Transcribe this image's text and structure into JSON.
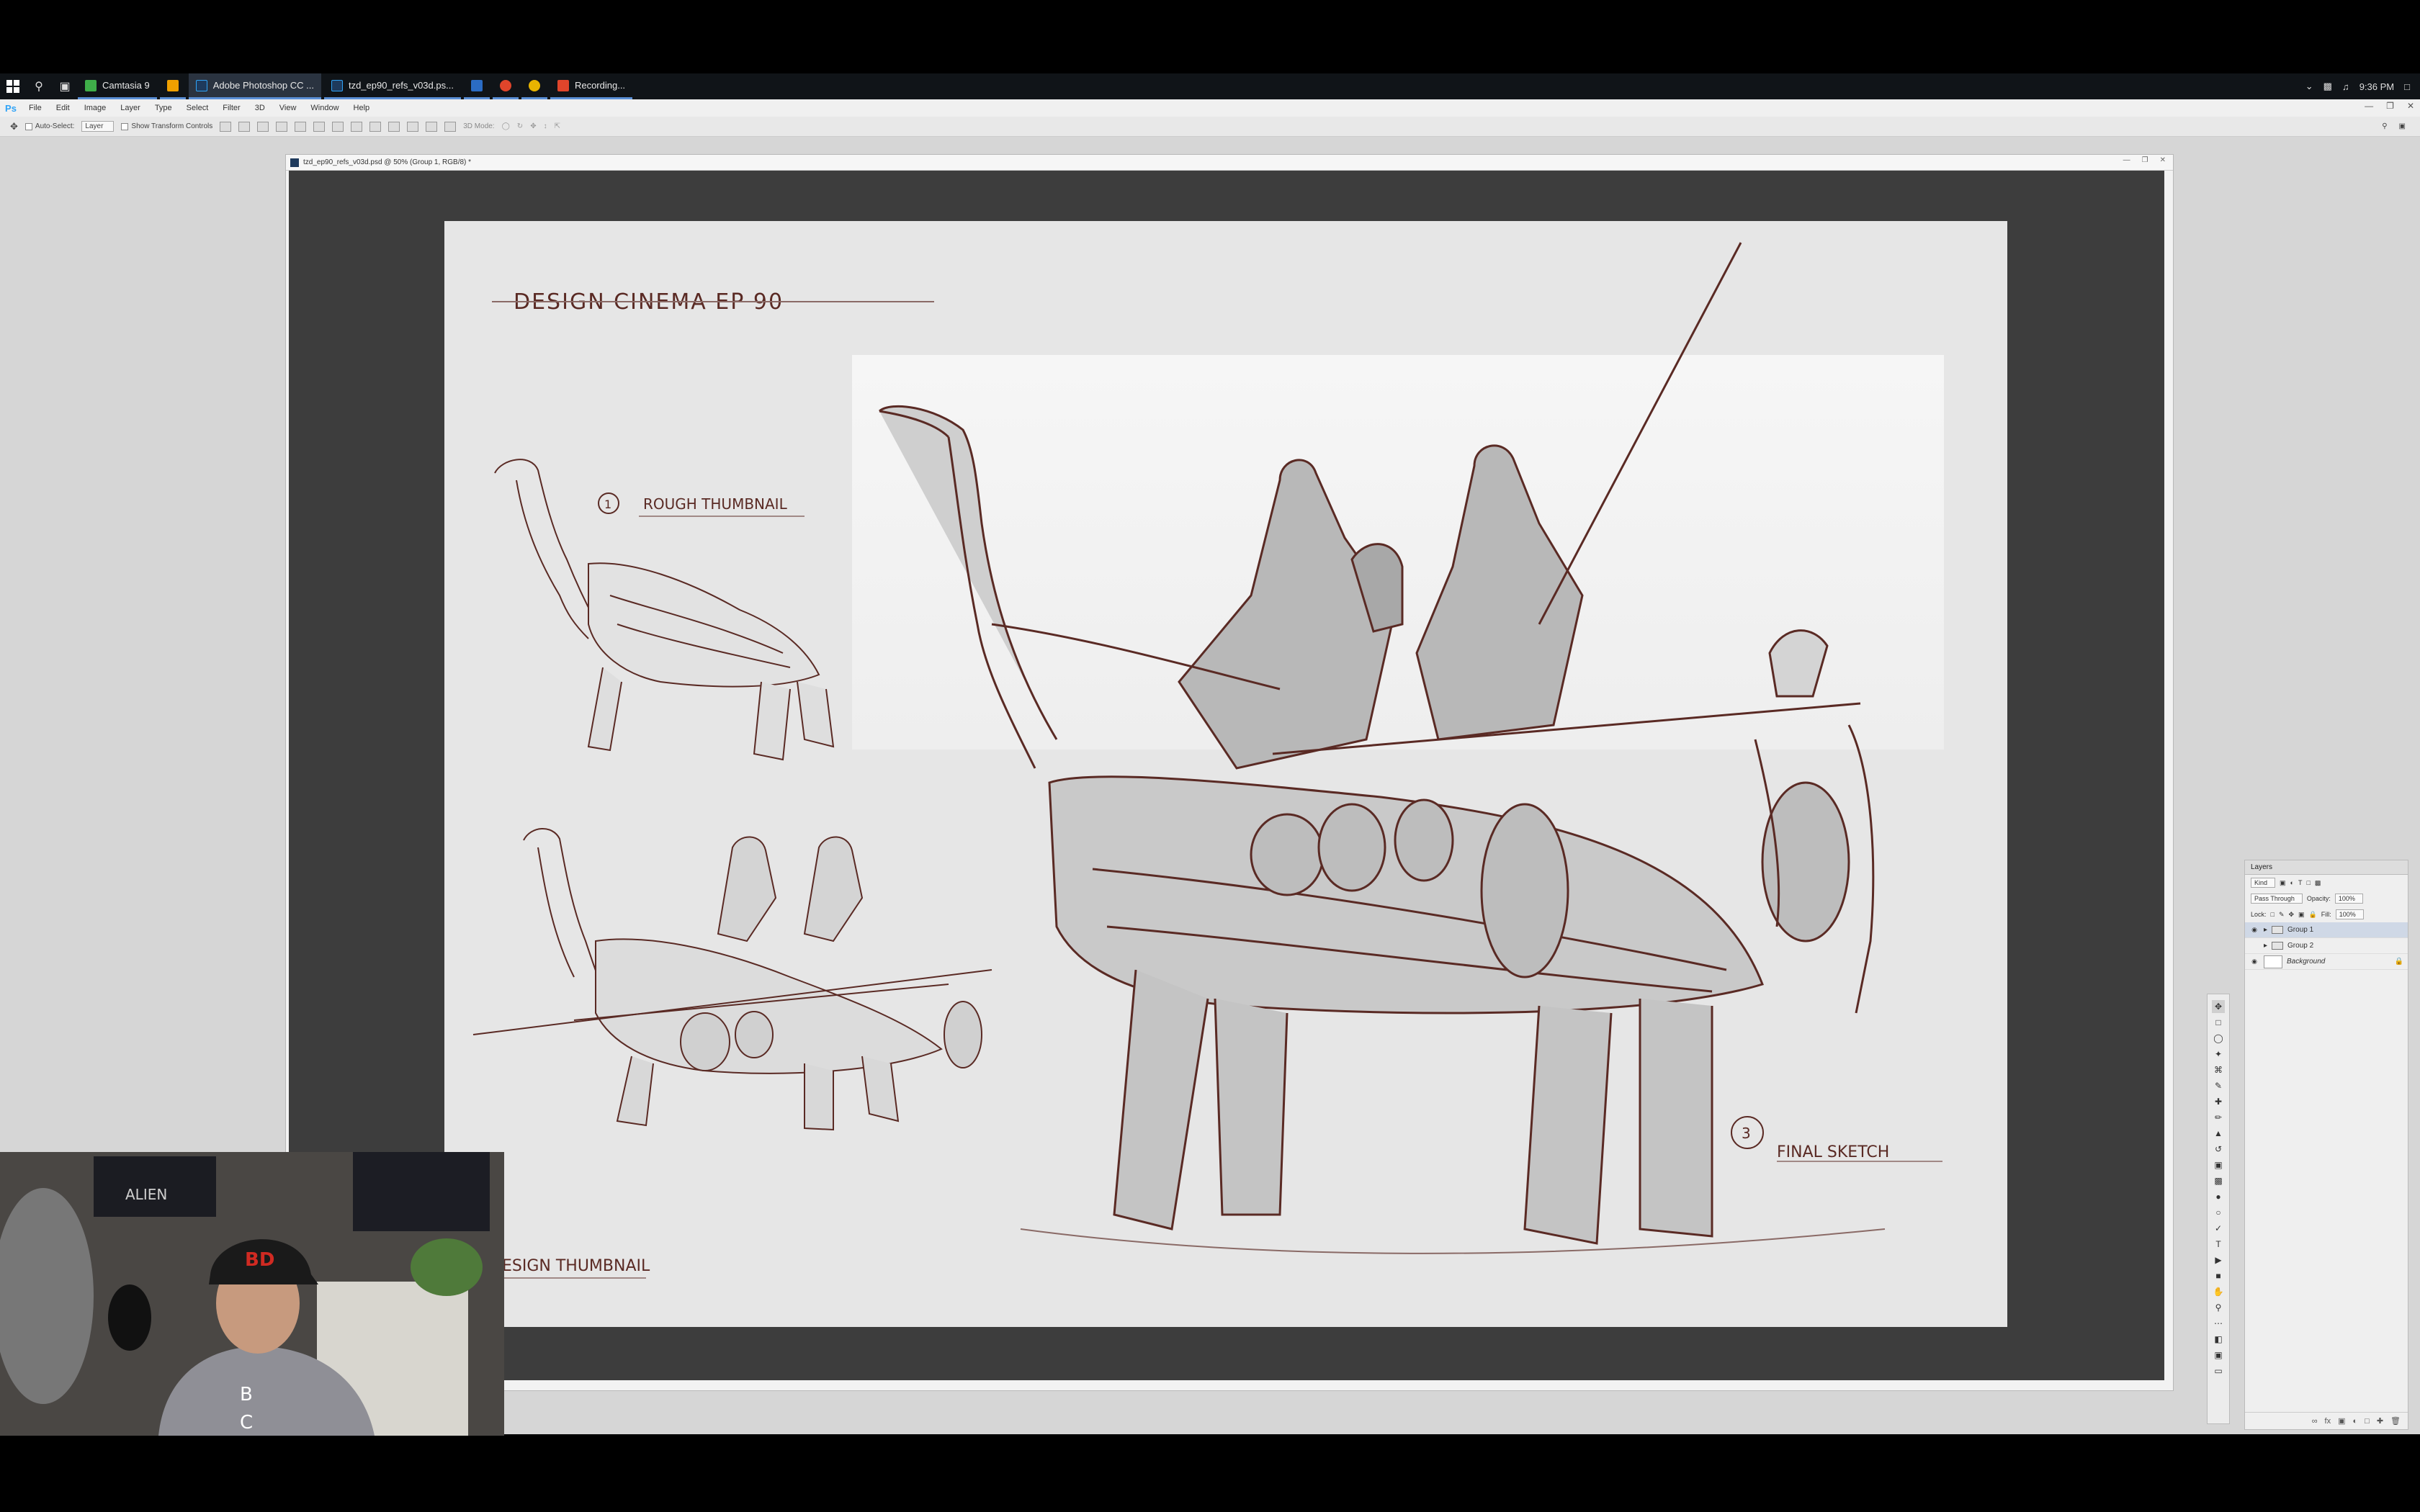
{
  "taskbar": {
    "apps": [
      {
        "label": "Camtasia 9",
        "color": "#3fae49",
        "active": false
      },
      {
        "label": "",
        "color": "#f0a000",
        "active": false
      },
      {
        "label": "Adobe Photoshop CC ...",
        "color": "#2fa3f7",
        "active": true
      },
      {
        "label": "tzd_ep90_refs_v03d.ps...",
        "color": "#2fa3f7",
        "active": false
      },
      {
        "label": "",
        "color": "#2b6cc4",
        "active": false
      },
      {
        "label": "",
        "color": "#e0452b",
        "active": false
      },
      {
        "label": "",
        "color": "#e8b400",
        "active": false
      },
      {
        "label": "Recording...",
        "color": "#e0452b",
        "active": false
      }
    ],
    "clock": "9:36 PM"
  },
  "menubar": {
    "logo": "Ps",
    "items": [
      "File",
      "Edit",
      "Image",
      "Layer",
      "Type",
      "Select",
      "Filter",
      "3D",
      "View",
      "Window",
      "Help"
    ]
  },
  "options": {
    "auto_select": "Auto-Select:",
    "auto_select_value": "Layer",
    "transform_controls": "Show Transform Controls",
    "mode_3d": "3D Mode:"
  },
  "document": {
    "title": "tzd_ep90_refs_v03d.psd @ 50% (Group 1, RGB/8) *"
  },
  "artwork": {
    "heading": "DESIGN CINEMA EP 90",
    "note_1_num": "1",
    "note_1_text": "ROUGH THUMBNAIL",
    "note_2_text": "ESIGN THUMBNAIL",
    "note_3_num": "3",
    "note_3_text": "FINAL SKETCH"
  },
  "layers_panel": {
    "tab": "Layers",
    "kind_label": "Kind",
    "blend_mode": "Pass Through",
    "opacity_label": "Opacity:",
    "opacity_value": "100%",
    "lock_label": "Lock:",
    "fill_label": "Fill:",
    "fill_value": "100%",
    "layers": [
      {
        "name": "Group 1",
        "type": "group",
        "visible": true,
        "selected": true
      },
      {
        "name": "Group 2",
        "type": "group",
        "visible": false,
        "selected": false
      },
      {
        "name": "Background",
        "type": "pixel",
        "visible": true,
        "selected": false,
        "locked": true
      }
    ]
  },
  "webcam": {
    "poster_text": "ALIEN",
    "cap_text": "BD",
    "shirt_text_1": "B",
    "shirt_text_2": "C"
  },
  "colors": {
    "sketch_line": "#5a2a24",
    "canvas_bg": "#e6e6e6",
    "pasteboard": "#3d3d3d",
    "workspace": "#d6d6d6"
  }
}
